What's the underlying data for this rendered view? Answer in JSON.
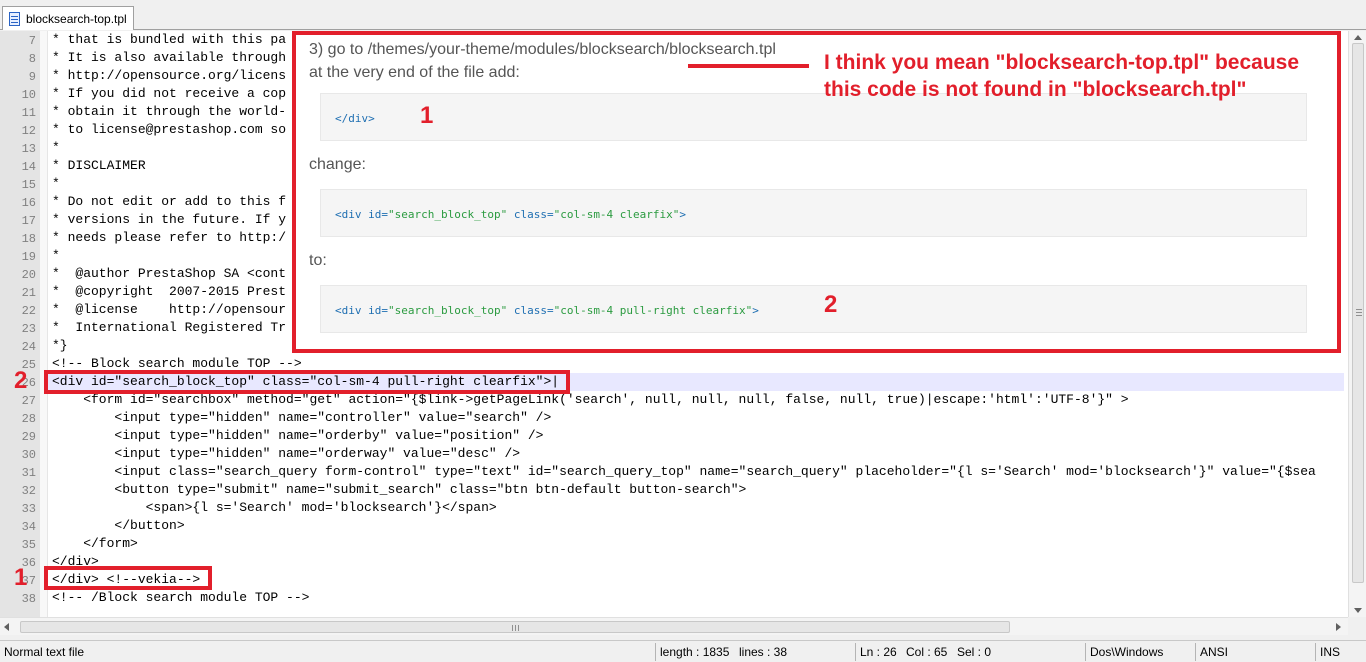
{
  "tab": {
    "label": "blocksearch-top.tpl"
  },
  "editor": {
    "lines": [
      {
        "n": "7",
        "text": "* that is bundled with this pa"
      },
      {
        "n": "8",
        "text": "* It is also available through"
      },
      {
        "n": "9",
        "text": "* http://opensource.org/licens"
      },
      {
        "n": "10",
        "text": "* If you did not receive a cop"
      },
      {
        "n": "11",
        "text": "* obtain it through the world-"
      },
      {
        "n": "12",
        "text": "* to license@prestashop.com so"
      },
      {
        "n": "13",
        "text": "*"
      },
      {
        "n": "14",
        "text": "* DISCLAIMER"
      },
      {
        "n": "15",
        "text": "*"
      },
      {
        "n": "16",
        "text": "* Do not edit or add to this f"
      },
      {
        "n": "17",
        "text": "* versions in the future. If y"
      },
      {
        "n": "18",
        "text": "* needs please refer to http:/"
      },
      {
        "n": "19",
        "text": "*"
      },
      {
        "n": "20",
        "text": "*  @author PrestaShop SA <cont"
      },
      {
        "n": "21",
        "text": "*  @copyright  2007-2015 Prest"
      },
      {
        "n": "22",
        "text": "*  @license    http://opensour"
      },
      {
        "n": "23",
        "text": "*  International Registered Tr"
      },
      {
        "n": "24",
        "text": "*}"
      },
      {
        "n": "25",
        "text": "<!-- Block search module TOP -->"
      },
      {
        "n": "26",
        "text": "<div id=\"search_block_top\" class=\"col-sm-4 pull-right clearfix\">|"
      },
      {
        "n": "27",
        "text": "    <form id=\"searchbox\" method=\"get\" action=\"{$link->getPageLink('search', null, null, null, false, null, true)|escape:'html':'UTF-8'}\" >"
      },
      {
        "n": "28",
        "text": "        <input type=\"hidden\" name=\"controller\" value=\"search\" />"
      },
      {
        "n": "29",
        "text": "        <input type=\"hidden\" name=\"orderby\" value=\"position\" />"
      },
      {
        "n": "30",
        "text": "        <input type=\"hidden\" name=\"orderway\" value=\"desc\" />"
      },
      {
        "n": "31",
        "text": "        <input class=\"search_query form-control\" type=\"text\" id=\"search_query_top\" name=\"search_query\" placeholder=\"{l s='Search' mod='blocksearch'}\" value=\"{$sea"
      },
      {
        "n": "32",
        "text": "        <button type=\"submit\" name=\"submit_search\" class=\"btn btn-default button-search\">"
      },
      {
        "n": "33",
        "text": "            <span>{l s='Search' mod='blocksearch'}</span>"
      },
      {
        "n": "34",
        "text": "        </button>"
      },
      {
        "n": "35",
        "text": "    </form>"
      },
      {
        "n": "36",
        "text": "</div>"
      },
      {
        "n": "37",
        "text": "</div> <!--vekia-->"
      },
      {
        "n": "38",
        "text": "<!-- /Block search module TOP -->"
      }
    ]
  },
  "overlay": {
    "step_text": "3) go to /themes/your-theme/modules/blocksearch/blocksearch.tpl",
    "step_sub": "at the very end of the file add:",
    "code1": "</div>",
    "change_label": "change:",
    "code2_tag": "<div ",
    "code2_attr1": "id=",
    "code2_val1": "\"search_block_top\"",
    "code2_attr2": " class=",
    "code2_val2": "\"col-sm-4 clearfix\"",
    "code2_end": ">",
    "to_label": "to:",
    "code3_val2": "\"col-sm-4 pull-right clearfix\"",
    "note": "I think you mean \"blocksearch-top.tpl\" because this code is not found in \"blocksearch.tpl\"",
    "num1": "1",
    "num2": "2"
  },
  "markers": {
    "one": "1",
    "two": "2"
  },
  "status": {
    "file_type": "Normal text file",
    "length": "length : 1835",
    "lines": "lines : 38",
    "ln": "Ln : 26",
    "col": "Col : 65",
    "sel": "Sel : 0",
    "eol": "Dos\\Windows",
    "encoding": "ANSI",
    "mode": "INS"
  },
  "colors": {
    "annotation_red": "#e21f2b",
    "current_line": "#e8e8ff"
  }
}
